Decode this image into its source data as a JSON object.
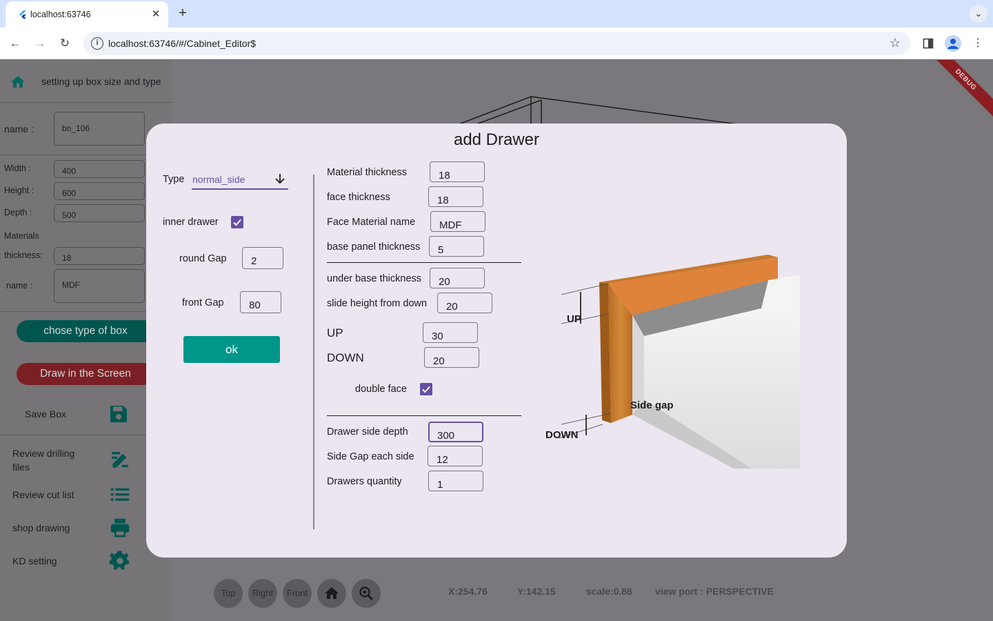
{
  "browser": {
    "tab_title": "localhost:63746",
    "url": "localhost:63746/#/Cabinet_Editor$",
    "tab_close": "✕",
    "new_tab": "+"
  },
  "sidebar": {
    "title": "setting up box size and type",
    "name_label": "name :",
    "name_value": "bo_106",
    "width_label": "Width :",
    "width_value": "400",
    "height_label": "Height :",
    "height_value": "600",
    "depth_label": "Depth  :",
    "depth_value": "500",
    "materials_label": "Materials",
    "thickness_label": "thickness:",
    "thickness_value": "18",
    "mat_name_label": "name :",
    "mat_name_value": "MDF",
    "chose_type_button": "chose type of box",
    "draw_button": "Draw in the Screen",
    "save_box": "Save Box",
    "review_drilling": "Review drilling files",
    "review_cut_list": "Review cut list",
    "shop_drawing": "shop drawing",
    "kd_setting": "KD setting"
  },
  "canvas": {
    "debug_banner": "DEBUG",
    "buttons": {
      "top": "Top",
      "right": "Right",
      "front": "Front"
    },
    "status_x": "X:254.76",
    "status_y": "Y:142.15",
    "status_scale": "scale:0.86",
    "status_viewport": "view port  : PERSPECTIVE"
  },
  "dialog": {
    "title": "add Drawer",
    "type_label": "Type",
    "type_value": "normal_side",
    "inner_drawer_label": "inner drawer",
    "inner_drawer_checked": true,
    "round_gap_label": "round Gap",
    "round_gap_value": "2",
    "front_gap_label": "front Gap",
    "front_gap_value": "80",
    "ok_button": "ok",
    "material_thickness_label": "Material thickness",
    "material_thickness_value": "18",
    "face_thickness_label": "face thickness",
    "face_thickness_value": "18",
    "face_material_label": "Face Material name",
    "face_material_value": "MDF",
    "base_panel_label": "base panel thickness",
    "base_panel_value": "5",
    "under_base_label": "under base thickness",
    "under_base_value": "20",
    "slide_height_label": "slide height from down",
    "slide_height_value": "20",
    "up_label": "UP",
    "up_value": "30",
    "down_label": "DOWN",
    "down_value": "20",
    "double_face_label": "double face",
    "double_face_checked": true,
    "side_depth_label": "Drawer side depth",
    "side_depth_value": "300",
    "side_gap_label": "Side Gap each side",
    "side_gap_value": "12",
    "quantity_label": "Drawers quantity",
    "quantity_value": "1",
    "illustration": {
      "up": "UP",
      "down": "DOWN",
      "side_gap": "Side gap"
    }
  },
  "colors": {
    "accent": "#6750a4",
    "teal": "#00968a",
    "red": "#c62828",
    "dialog_bg": "#ece6f0"
  }
}
